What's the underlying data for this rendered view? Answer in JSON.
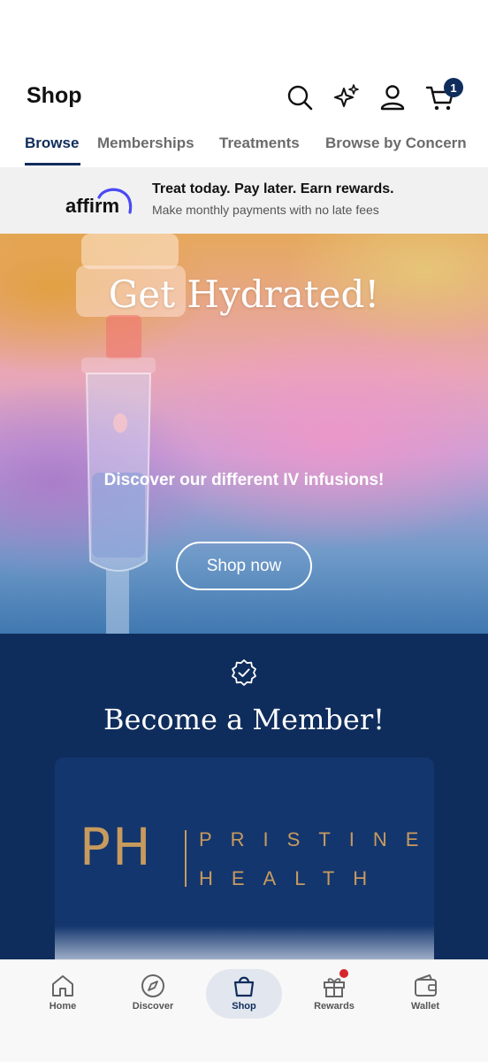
{
  "header": {
    "title": "Shop",
    "cart_count": "1",
    "icons": [
      "search-icon",
      "sparkle-icon",
      "user-icon",
      "cart-icon"
    ]
  },
  "tabs": [
    {
      "label": "Browse",
      "active": true
    },
    {
      "label": "Memberships",
      "active": false
    },
    {
      "label": "Treatments",
      "active": false
    },
    {
      "label": "Browse by Concern",
      "active": false
    }
  ],
  "affirm": {
    "logo_text": "affirm",
    "headline": "Treat today. Pay later. Earn rewards.",
    "subtext": "Make monthly payments with no late fees"
  },
  "hero": {
    "title": "Get Hydrated!",
    "subtitle": "Discover our different IV infusions!",
    "button_label": "Shop now"
  },
  "member": {
    "title": "Become a Member!",
    "icon": "verified-badge-icon",
    "card": {
      "logo_initials": "PH",
      "brand_line1": "PRISTINE",
      "brand_line2": "HEALTH"
    }
  },
  "bottom_nav": [
    {
      "label": "Home",
      "icon": "home-icon",
      "active": false
    },
    {
      "label": "Discover",
      "icon": "compass-icon",
      "active": false
    },
    {
      "label": "Shop",
      "icon": "shopping-bag-icon",
      "active": true
    },
    {
      "label": "Rewards",
      "icon": "gift-icon",
      "active": false,
      "has_notification": true
    },
    {
      "label": "Wallet",
      "icon": "wallet-icon",
      "active": false
    }
  ],
  "colors": {
    "brand_navy": "#0f2d5c",
    "gold": "#c79b5e",
    "notification_red": "#d7262b",
    "affirm_blue": "#4a4af4"
  }
}
